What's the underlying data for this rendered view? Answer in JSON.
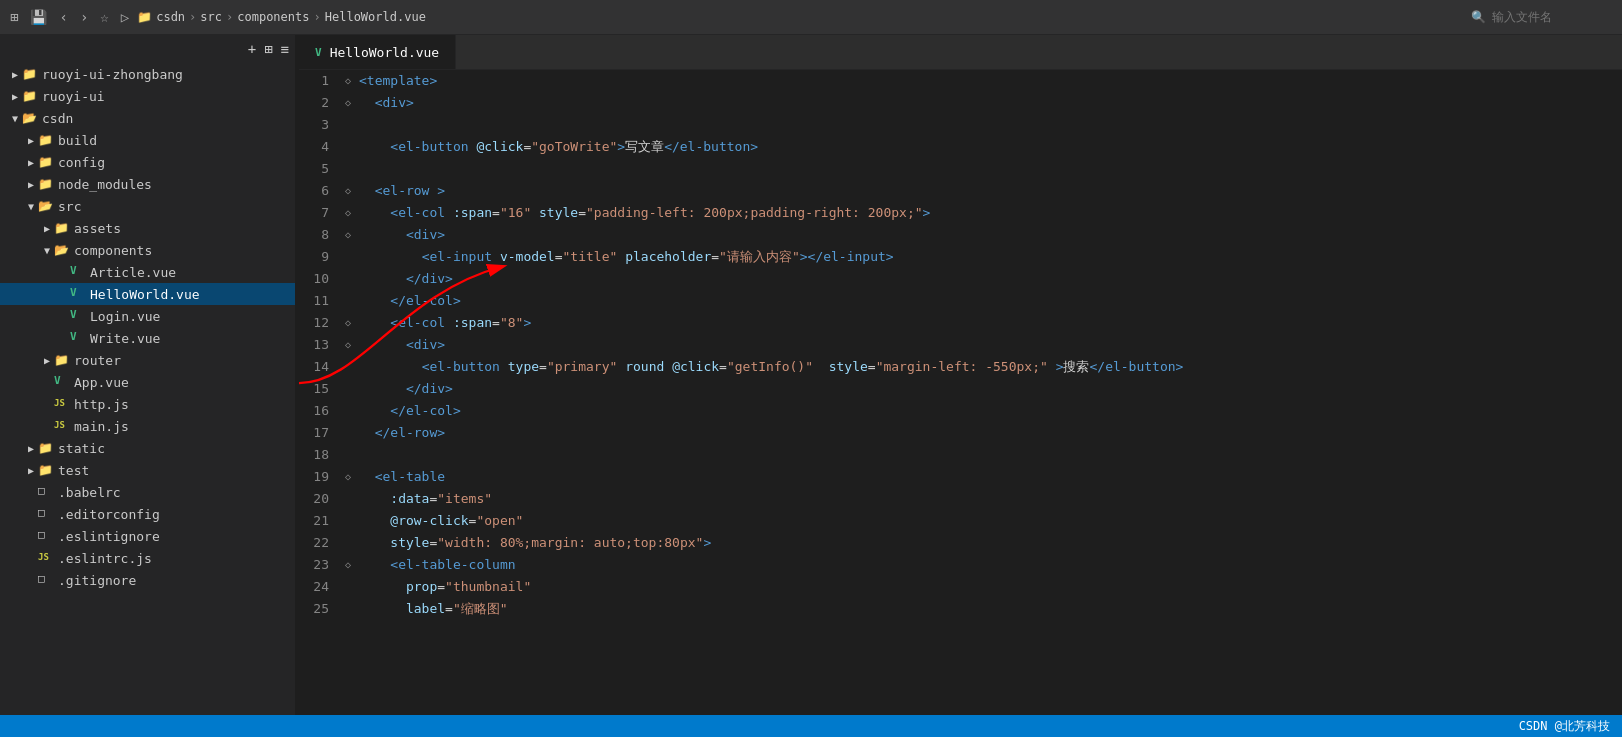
{
  "titleBar": {
    "breadcrumb": [
      "csdn",
      "src",
      "components",
      "HelloWorld.vue"
    ],
    "fileInputPlaceholder": "输入文件名"
  },
  "sidebar": {
    "items": [
      {
        "id": "ruoyi-ui-zhongbang",
        "label": "ruoyi-ui-zhongbang",
        "type": "folder",
        "indent": 0,
        "state": "closed"
      },
      {
        "id": "ruoyi-ui",
        "label": "ruoyi-ui",
        "type": "folder",
        "indent": 0,
        "state": "closed"
      },
      {
        "id": "csdn",
        "label": "csdn",
        "type": "folder",
        "indent": 0,
        "state": "open"
      },
      {
        "id": "build",
        "label": "build",
        "type": "folder",
        "indent": 1,
        "state": "closed"
      },
      {
        "id": "config",
        "label": "config",
        "type": "folder",
        "indent": 1,
        "state": "closed"
      },
      {
        "id": "node_modules",
        "label": "node_modules",
        "type": "folder",
        "indent": 1,
        "state": "closed"
      },
      {
        "id": "src",
        "label": "src",
        "type": "folder",
        "indent": 1,
        "state": "open"
      },
      {
        "id": "assets",
        "label": "assets",
        "type": "folder",
        "indent": 2,
        "state": "closed"
      },
      {
        "id": "components",
        "label": "components",
        "type": "folder",
        "indent": 2,
        "state": "open"
      },
      {
        "id": "Article.vue",
        "label": "Article.vue",
        "type": "vue",
        "indent": 3,
        "state": "none"
      },
      {
        "id": "HelloWorld.vue",
        "label": "HelloWorld.vue",
        "type": "vue",
        "indent": 3,
        "state": "none",
        "active": true
      },
      {
        "id": "Login.vue",
        "label": "Login.vue",
        "type": "vue",
        "indent": 3,
        "state": "none"
      },
      {
        "id": "Write.vue",
        "label": "Write.vue",
        "type": "vue",
        "indent": 3,
        "state": "none"
      },
      {
        "id": "router",
        "label": "router",
        "type": "folder",
        "indent": 2,
        "state": "closed"
      },
      {
        "id": "App.vue",
        "label": "App.vue",
        "type": "vue",
        "indent": 2,
        "state": "none"
      },
      {
        "id": "http.js",
        "label": "http.js",
        "type": "js",
        "indent": 2,
        "state": "none"
      },
      {
        "id": "main.js",
        "label": "main.js",
        "type": "js",
        "indent": 2,
        "state": "none"
      },
      {
        "id": "static",
        "label": "static",
        "type": "folder",
        "indent": 1,
        "state": "closed"
      },
      {
        "id": "test",
        "label": "test",
        "type": "folder",
        "indent": 1,
        "state": "closed"
      },
      {
        "id": ".babelrc",
        "label": ".babelrc",
        "type": "generic",
        "indent": 1,
        "state": "none"
      },
      {
        "id": ".editorconfig",
        "label": ".editorconfig",
        "type": "generic",
        "indent": 1,
        "state": "none"
      },
      {
        "id": ".eslintignore",
        "label": ".eslintignore",
        "type": "generic",
        "indent": 1,
        "state": "none"
      },
      {
        "id": ".eslintrc.js",
        "label": ".eslintrc.js",
        "type": "js",
        "indent": 1,
        "state": "none"
      },
      {
        "id": ".gitignore",
        "label": ".gitignore",
        "type": "generic",
        "indent": 1,
        "state": "none"
      }
    ]
  },
  "tab": {
    "label": "HelloWorld.vue"
  },
  "codeLines": [
    {
      "num": 1,
      "fold": "◇",
      "content": [
        {
          "type": "tag",
          "text": "<template>"
        }
      ]
    },
    {
      "num": 2,
      "fold": "◇",
      "content": [
        {
          "type": "text",
          "text": "  "
        },
        {
          "type": "tag",
          "text": "<div>"
        }
      ]
    },
    {
      "num": 3,
      "fold": "",
      "content": []
    },
    {
      "num": 4,
      "fold": "",
      "content": [
        {
          "type": "text",
          "text": "    "
        },
        {
          "type": "tag",
          "text": "<el-button"
        },
        {
          "type": "text",
          "text": " "
        },
        {
          "type": "attr",
          "text": "@click"
        },
        {
          "type": "punct",
          "text": "="
        },
        {
          "type": "val",
          "text": "\"goToWrite\""
        },
        {
          "type": "tag",
          "text": ">"
        },
        {
          "type": "chinese",
          "text": "写文章"
        },
        {
          "type": "tag",
          "text": "</el-button>"
        }
      ]
    },
    {
      "num": 5,
      "fold": "",
      "content": []
    },
    {
      "num": 6,
      "fold": "◇",
      "content": [
        {
          "type": "text",
          "text": "  "
        },
        {
          "type": "tag",
          "text": "<el-row"
        },
        {
          "type": "text",
          "text": " "
        },
        {
          "type": "tag",
          "text": ">"
        }
      ]
    },
    {
      "num": 7,
      "fold": "◇",
      "content": [
        {
          "type": "text",
          "text": "    "
        },
        {
          "type": "tag",
          "text": "<el-col"
        },
        {
          "type": "text",
          "text": " "
        },
        {
          "type": "attr",
          "text": ":span"
        },
        {
          "type": "punct",
          "text": "="
        },
        {
          "type": "val",
          "text": "\"16\""
        },
        {
          "type": "text",
          "text": " "
        },
        {
          "type": "attr",
          "text": "style"
        },
        {
          "type": "punct",
          "text": "="
        },
        {
          "type": "val",
          "text": "\"padding-left: 200px;padding-right: 200px;\""
        },
        {
          "type": "tag",
          "text": ">"
        }
      ]
    },
    {
      "num": 8,
      "fold": "◇",
      "content": [
        {
          "type": "text",
          "text": "      "
        },
        {
          "type": "tag",
          "text": "<div>"
        }
      ]
    },
    {
      "num": 9,
      "fold": "",
      "content": [
        {
          "type": "text",
          "text": "        "
        },
        {
          "type": "tag",
          "text": "<el-input"
        },
        {
          "type": "text",
          "text": " "
        },
        {
          "type": "attr",
          "text": "v-model"
        },
        {
          "type": "punct",
          "text": "="
        },
        {
          "type": "val",
          "text": "\"title\""
        },
        {
          "type": "text",
          "text": " "
        },
        {
          "type": "attr",
          "text": "placeholder"
        },
        {
          "type": "punct",
          "text": "="
        },
        {
          "type": "val",
          "text": "\"请输入内容\""
        },
        {
          "type": "tag",
          "text": "></el-input>"
        }
      ]
    },
    {
      "num": 10,
      "fold": "",
      "content": [
        {
          "type": "text",
          "text": "      "
        },
        {
          "type": "tag",
          "text": "</div>"
        }
      ]
    },
    {
      "num": 11,
      "fold": "",
      "content": [
        {
          "type": "text",
          "text": "    "
        },
        {
          "type": "tag",
          "text": "</el-col>"
        }
      ]
    },
    {
      "num": 12,
      "fold": "◇",
      "content": [
        {
          "type": "text",
          "text": "    "
        },
        {
          "type": "tag",
          "text": "<el-col"
        },
        {
          "type": "text",
          "text": " "
        },
        {
          "type": "attr",
          "text": ":span"
        },
        {
          "type": "punct",
          "text": "="
        },
        {
          "type": "val",
          "text": "\"8\""
        },
        {
          "type": "tag",
          "text": ">"
        }
      ]
    },
    {
      "num": 13,
      "fold": "◇",
      "content": [
        {
          "type": "text",
          "text": "      "
        },
        {
          "type": "tag",
          "text": "<div>"
        }
      ]
    },
    {
      "num": 14,
      "fold": "",
      "content": [
        {
          "type": "text",
          "text": "        "
        },
        {
          "type": "tag",
          "text": "<el-button"
        },
        {
          "type": "text",
          "text": " "
        },
        {
          "type": "attr",
          "text": "type"
        },
        {
          "type": "punct",
          "text": "="
        },
        {
          "type": "val",
          "text": "\"primary\""
        },
        {
          "type": "text",
          "text": " "
        },
        {
          "type": "attr",
          "text": "round"
        },
        {
          "type": "text",
          "text": " "
        },
        {
          "type": "attr",
          "text": "@click"
        },
        {
          "type": "punct",
          "text": "="
        },
        {
          "type": "val",
          "text": "\"getInfo()\""
        },
        {
          "type": "text",
          "text": "  "
        },
        {
          "type": "attr",
          "text": "style"
        },
        {
          "type": "punct",
          "text": "="
        },
        {
          "type": "val",
          "text": "\"margin-left: -550px;\""
        },
        {
          "type": "text",
          "text": " "
        },
        {
          "type": "tag",
          "text": ">"
        },
        {
          "type": "chinese",
          "text": "搜索"
        },
        {
          "type": "tag",
          "text": "</el-button>"
        }
      ]
    },
    {
      "num": 15,
      "fold": "",
      "content": [
        {
          "type": "text",
          "text": "      "
        },
        {
          "type": "tag",
          "text": "</div>"
        }
      ]
    },
    {
      "num": 16,
      "fold": "",
      "content": [
        {
          "type": "text",
          "text": "    "
        },
        {
          "type": "tag",
          "text": "</el-col>"
        }
      ]
    },
    {
      "num": 17,
      "fold": "",
      "content": [
        {
          "type": "text",
          "text": "  "
        },
        {
          "type": "tag",
          "text": "</el-row>"
        }
      ]
    },
    {
      "num": 18,
      "fold": "",
      "content": []
    },
    {
      "num": 19,
      "fold": "◇",
      "content": [
        {
          "type": "text",
          "text": "  "
        },
        {
          "type": "tag",
          "text": "<el-table"
        }
      ]
    },
    {
      "num": 20,
      "fold": "",
      "content": [
        {
          "type": "text",
          "text": "    "
        },
        {
          "type": "attr",
          "text": ":data"
        },
        {
          "type": "punct",
          "text": "="
        },
        {
          "type": "val",
          "text": "\"items\""
        }
      ]
    },
    {
      "num": 21,
      "fold": "",
      "content": [
        {
          "type": "text",
          "text": "    "
        },
        {
          "type": "attr",
          "text": "@row-click"
        },
        {
          "type": "punct",
          "text": "="
        },
        {
          "type": "val",
          "text": "\"open\""
        }
      ]
    },
    {
      "num": 22,
      "fold": "",
      "content": [
        {
          "type": "text",
          "text": "    "
        },
        {
          "type": "attr",
          "text": "style"
        },
        {
          "type": "punct",
          "text": "="
        },
        {
          "type": "val",
          "text": "\"width: 80%;margin: auto;top:80px\""
        },
        {
          "type": "tag",
          "text": ">"
        }
      ]
    },
    {
      "num": 23,
      "fold": "◇",
      "content": [
        {
          "type": "text",
          "text": "    "
        },
        {
          "type": "tag",
          "text": "<el-table-column"
        }
      ]
    },
    {
      "num": 24,
      "fold": "",
      "content": [
        {
          "type": "text",
          "text": "      "
        },
        {
          "type": "attr",
          "text": "prop"
        },
        {
          "type": "punct",
          "text": "="
        },
        {
          "type": "val",
          "text": "\"thumbnail\""
        }
      ]
    },
    {
      "num": 25,
      "fold": "",
      "content": [
        {
          "type": "text",
          "text": "      "
        },
        {
          "type": "attr",
          "text": "label"
        },
        {
          "type": "punct",
          "text": "="
        },
        {
          "type": "val",
          "text": "\"缩略图\""
        }
      ]
    }
  ],
  "statusBar": {
    "text": "CSDN @北芳科技"
  },
  "colors": {
    "background": "#1e1e1e",
    "sidebar": "#252526",
    "tabBar": "#2d2d2d",
    "activeTab": "#1e1e1e",
    "statusBar": "#007acc",
    "tag": "#569cd6",
    "attr": "#9cdcfe",
    "val": "#ce9178",
    "cursor": "#1e90ff"
  }
}
